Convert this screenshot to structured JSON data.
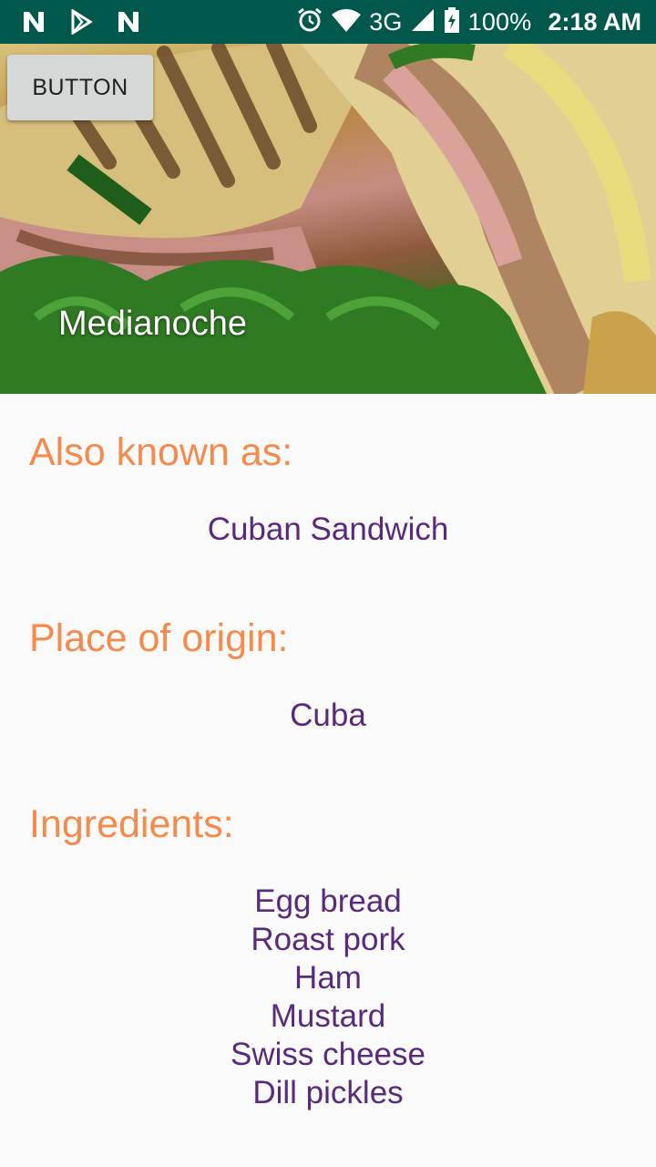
{
  "status_bar": {
    "left_icons": [
      "n-notification-icon",
      "play-store-icon",
      "n-notification-icon"
    ],
    "network": "3G",
    "battery": "100%",
    "time": "2:18 AM"
  },
  "hero": {
    "button_label": "BUTTON",
    "title": "Medianoche"
  },
  "details": {
    "aka_heading": "Also known as:",
    "aka_value": "Cuban Sandwich",
    "origin_heading": "Place of origin:",
    "origin_value": "Cuba",
    "ingredients_heading": "Ingredients:",
    "ingredients": [
      "Egg bread",
      "Roast pork",
      "Ham",
      "Mustard",
      "Swiss cheese",
      "Dill pickles"
    ]
  },
  "colors": {
    "status_bar": "#00574b",
    "heading": "#f58a4b",
    "value": "#5a2a7a",
    "background": "#fafafa"
  }
}
